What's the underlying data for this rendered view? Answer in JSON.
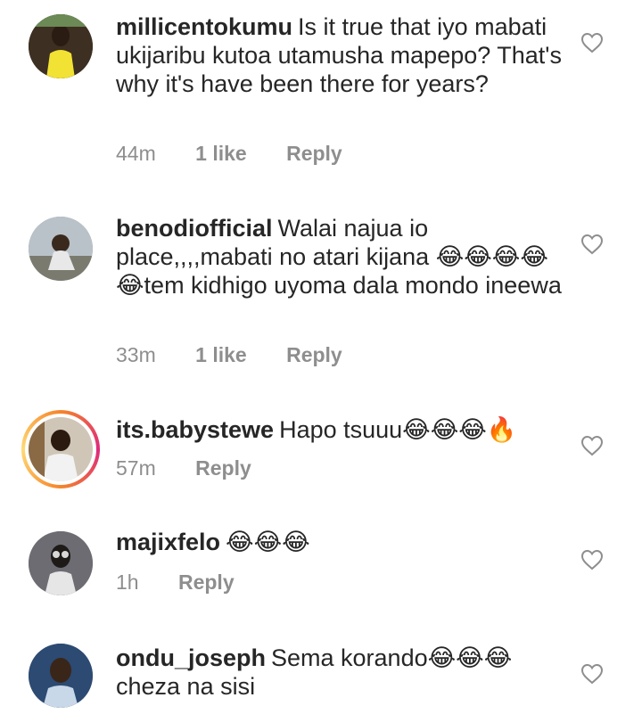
{
  "comments": [
    {
      "username": "millicentokumu",
      "text": "Is it true that iyo mabati ukijaribu kutoa utamusha mapepo? That's why it's have been there for years?",
      "emoji": "",
      "time": "44m",
      "likes": "1 like",
      "reply": "Reply"
    },
    {
      "username": "benodiofficial",
      "text": "Walai najua io place,,,,mabati no atari kijana 😂😂😂😂😂tem kidhigo uyoma dala mondo ineewa",
      "emoji": "",
      "time": "33m",
      "likes": "1 like",
      "reply": "Reply"
    },
    {
      "username": "its.babystewe",
      "text": "Hapo tsuuu😂😂😂🔥",
      "emoji": "",
      "time": "57m",
      "likes": "",
      "reply": "Reply"
    },
    {
      "username": "majixfelo",
      "text": "😂😂😂",
      "emoji": "",
      "time": "1h",
      "likes": "",
      "reply": "Reply"
    },
    {
      "username": "ondu_joseph",
      "text": "Sema korando😂😂😂 cheza na sisi",
      "emoji": "",
      "time": "",
      "likes": "",
      "reply": ""
    }
  ],
  "icons": {
    "like": "heart-outline-icon"
  },
  "colors": {
    "text": "#262626",
    "meta": "#8e8e8e",
    "story_ring_start": "#f58529",
    "story_ring_end": "#dd2a7b"
  }
}
